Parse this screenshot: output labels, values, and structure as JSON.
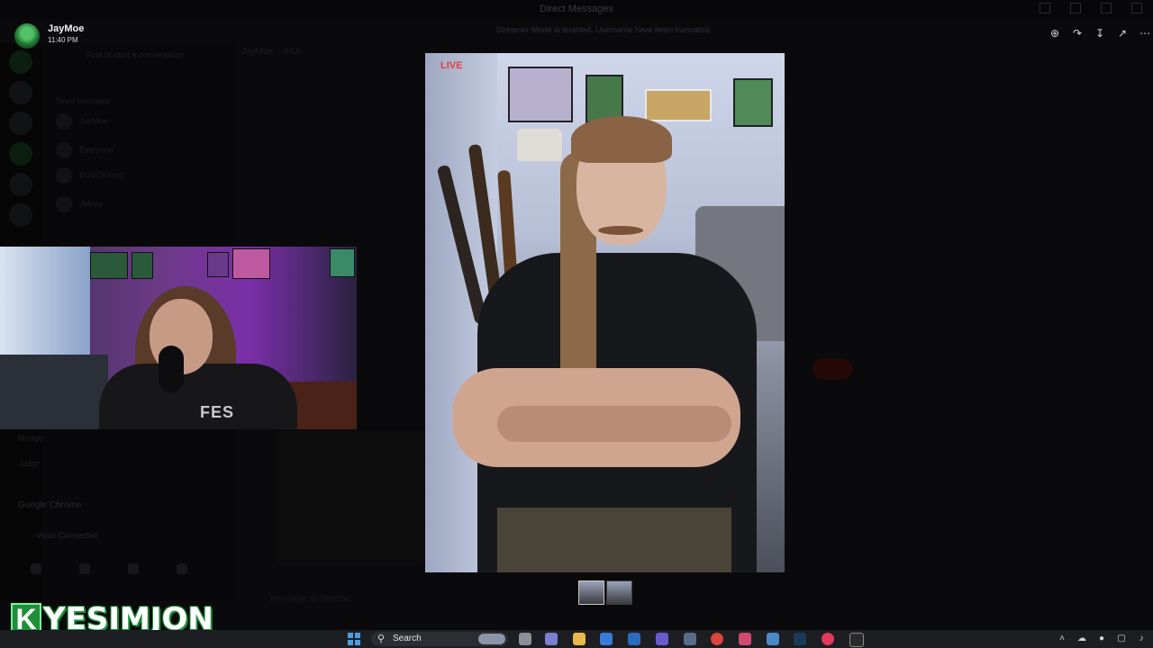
{
  "window": {
    "title": "Direct Messages",
    "notice": "Streamer Mode is enabled. Username have been truncated."
  },
  "profile": {
    "name": "JayMoe",
    "time": "11:40 PM"
  },
  "dm_list": {
    "search_placeholder": "Find or start a conversation",
    "header": "Direct Messages",
    "items": [
      "JayMoe",
      "Everyone",
      "BOVOmusic",
      "Jolinia"
    ],
    "lower": [
      "Mudge",
      "Judge"
    ]
  },
  "chat": {
    "header": "JayMoe",
    "aka": "AKA",
    "input_placeholder": "Message @JayMoe"
  },
  "voice": {
    "app": "Google Chrome",
    "status": "Voice Connected"
  },
  "viewer": {
    "tools": [
      "zoom-in-icon",
      "forward-icon",
      "download-icon",
      "open-external-icon",
      "more-icon"
    ],
    "thumbnail_count": 2,
    "selected_thumbnail": 1
  },
  "webcam": {
    "shirt_text": "FES"
  },
  "logo": {
    "letter": "K",
    "text": "YESIMJON",
    "accent": "#1f8f3a"
  },
  "taskbar": {
    "search_label": "Search"
  },
  "photo_neon": "LIVE"
}
